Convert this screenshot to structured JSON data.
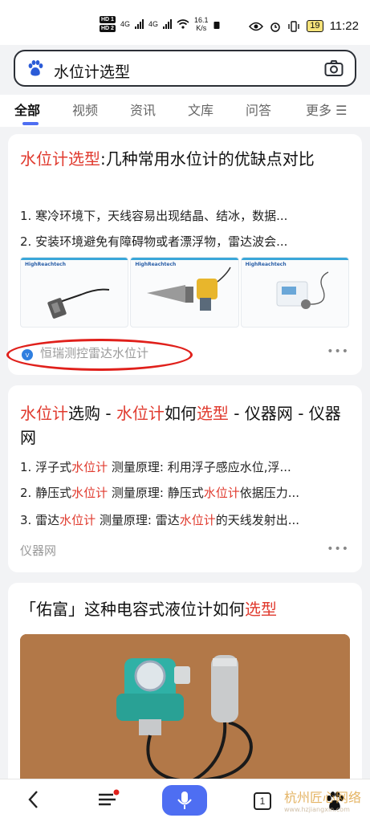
{
  "status_bar": {
    "hd1": "HD 1",
    "hd2": "HD 2",
    "net1": "4G",
    "net2": "4G",
    "speed_value": "16.1",
    "speed_unit": "K/s",
    "battery": "19",
    "time": "11:22"
  },
  "search": {
    "query": "水位计选型",
    "logo_icon": "baidu-paw-icon",
    "camera_icon": "camera-icon"
  },
  "tabs": [
    {
      "label": "全部",
      "active": true
    },
    {
      "label": "视频",
      "active": false
    },
    {
      "label": "资讯",
      "active": false
    },
    {
      "label": "文库",
      "active": false
    },
    {
      "label": "问答",
      "active": false
    },
    {
      "label": "更多 ☰",
      "active": false
    }
  ],
  "results": [
    {
      "title_parts": [
        {
          "text": "水位计选型",
          "highlight": true
        },
        {
          "text": ":几种常用水位计的优缺点对比",
          "highlight": false
        }
      ],
      "lines": [
        "1. 寒冷环境下，天线容易出现结晶、结冰，数据...",
        "2. 安装环境避免有障碍物或者漂浮物，雷达波会..."
      ],
      "thumb_brand": "HighReachtech",
      "source": "恒瑞测控雷达水位计",
      "more": "•••"
    },
    {
      "title_parts": [
        {
          "text": "水位计",
          "highlight": true
        },
        {
          "text": "选购 - ",
          "highlight": false
        },
        {
          "text": "水位计",
          "highlight": true
        },
        {
          "text": "如何",
          "highlight": false
        },
        {
          "text": "选型",
          "highlight": true
        },
        {
          "text": " - 仪器网 - 仪器网",
          "highlight": false
        }
      ],
      "lines": [
        [
          {
            "text": "1. 浮子式",
            "highlight": false
          },
          {
            "text": "水位计",
            "highlight": true
          },
          {
            "text": " 测量原理: 利用浮子感应水位,浮...",
            "highlight": false
          }
        ],
        [
          {
            "text": "2. 静压式",
            "highlight": false
          },
          {
            "text": "水位计",
            "highlight": true
          },
          {
            "text": " 测量原理: 静压式",
            "highlight": false
          },
          {
            "text": "水位计",
            "highlight": true
          },
          {
            "text": "依据压力...",
            "highlight": false
          }
        ],
        [
          {
            "text": "3. 雷达",
            "highlight": false
          },
          {
            "text": "水位计",
            "highlight": true
          },
          {
            "text": " 测量原理: 雷达",
            "highlight": false
          },
          {
            "text": "水位计",
            "highlight": true
          },
          {
            "text": "的天线发射出...",
            "highlight": false
          }
        ]
      ],
      "source": "仪器网",
      "more": "•••"
    },
    {
      "title_parts": [
        {
          "text": "「佑富」这种电容式液位计如何",
          "highlight": false
        },
        {
          "text": "选型",
          "highlight": true
        }
      ]
    }
  ],
  "bottom_nav": {
    "back_icon": "back-arrow-icon",
    "menu_icon": "menu-icon",
    "mic_icon": "microphone-icon",
    "tab_count": "1",
    "home_icon": "baidu-paw-icon"
  },
  "watermark": {
    "text": "杭州匠心网络",
    "url": "www.hzjiangxin.com"
  },
  "colors": {
    "highlight": "#e03a2e",
    "accent": "#4e6ef2",
    "annotation": "#e0201b"
  }
}
